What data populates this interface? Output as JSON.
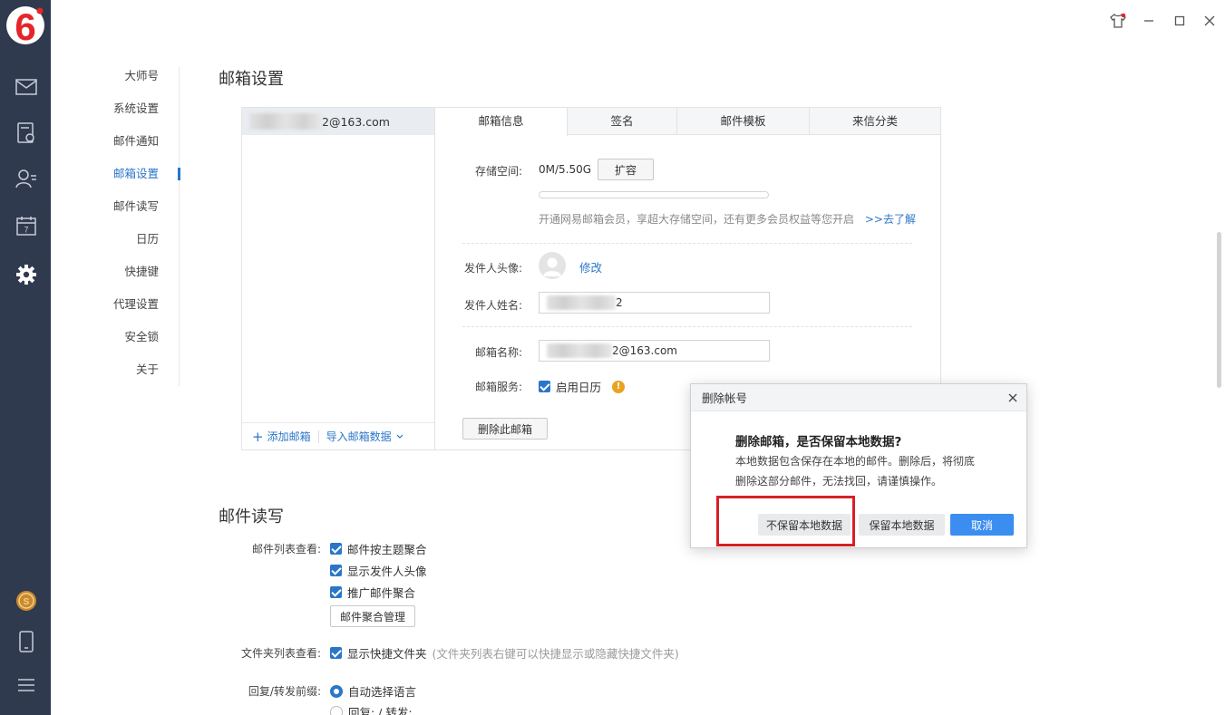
{
  "colors": {
    "accent": "#2b76c8",
    "rail": "#2f3a4f",
    "logo_red": "#e4262a",
    "highlight": "#d62027",
    "warning": "#e9a221"
  },
  "rail_icons": [
    "app-logo",
    "mail-icon",
    "contacts-file-icon",
    "contact-icon",
    "calendar-icon",
    "settings-gear-icon",
    "coin-icon",
    "phone-icon",
    "menu-icon"
  ],
  "logo": {
    "text": "6"
  },
  "nav": {
    "items": [
      "大师号",
      "系统设置",
      "邮件通知",
      "邮箱设置",
      "邮件读写",
      "日历",
      "快捷键",
      "代理设置",
      "安全锁",
      "关于"
    ],
    "active": "邮箱设置"
  },
  "mailbox_section": {
    "title": "邮箱设置",
    "account_suffix": "2@163.com",
    "add_mailbox": "添加邮箱",
    "import_data": "导入邮箱数据",
    "tabs": [
      "邮箱信息",
      "签名",
      "邮件模板",
      "来信分类"
    ],
    "storage_label": "存储空间:",
    "storage_value": "0M/5.50G",
    "expand_btn": "扩容",
    "storage_used_fraction": 0,
    "promo_text": "开通网易邮箱会员，享超大存储空间，还有更多会员权益等您开启",
    "promo_link": ">>去了解",
    "avatar_label": "发件人头像:",
    "avatar_edit": "修改",
    "sender_name_label": "发件人姓名:",
    "sender_name_suffix": "2",
    "mailbox_name_label": "邮箱名称:",
    "mailbox_name_suffix": "2@163.com",
    "service_label": "邮箱服务:",
    "service_calendar": "启用日历",
    "delete_btn": "删除此邮箱"
  },
  "rw_section": {
    "title": "邮件读写",
    "list_view_label": "邮件列表查看:",
    "opt_thread": "邮件按主题聚合",
    "opt_avatar": "显示发件人头像",
    "opt_promo": "推广邮件聚合",
    "manage_btn": "邮件聚合管理",
    "folder_view_label": "文件夹列表查看:",
    "opt_quick_folder": "显示快捷文件夹",
    "folder_hint": "(文件夹列表右键可以快捷显示或隐藏快捷文件夹)",
    "prefix_label": "回复/转发前缀:",
    "opt_auto_lang": "自动选择语言",
    "opt_cn_prefix": "回复: / 转发:"
  },
  "dialog": {
    "title": "删除帐号",
    "question": "删除邮箱，是否保留本地数据?",
    "desc_line1": "本地数据包含保存在本地的邮件。删除后，将彻底",
    "desc_line2": "删除这部分邮件，无法找回，请谨慎操作。",
    "btn_no_keep": "不保留本地数据",
    "btn_keep": "保留本地数据",
    "btn_cancel": "取消"
  }
}
